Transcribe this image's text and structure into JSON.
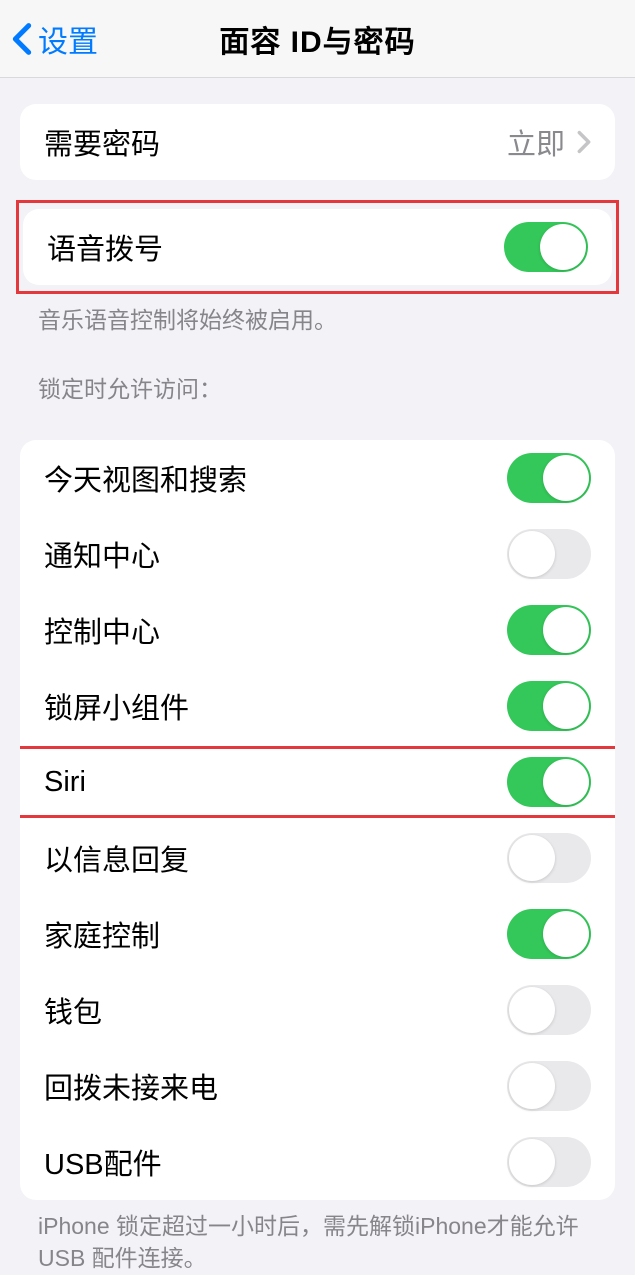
{
  "nav": {
    "back_label": "设置",
    "title": "面容 ID与密码"
  },
  "require_passcode": {
    "label": "需要密码",
    "value": "立即"
  },
  "voice_dial": {
    "label": "语音拨号",
    "on": true,
    "footer": "音乐语音控制将始终被启用。"
  },
  "lock_screen_access": {
    "header": "锁定时允许访问：",
    "items": [
      {
        "label": "今天视图和搜索",
        "on": true,
        "highlighted": false
      },
      {
        "label": "通知中心",
        "on": false,
        "highlighted": false
      },
      {
        "label": "控制中心",
        "on": true,
        "highlighted": false
      },
      {
        "label": "锁屏小组件",
        "on": true,
        "highlighted": false
      },
      {
        "label": "Siri",
        "on": true,
        "highlighted": true
      },
      {
        "label": "以信息回复",
        "on": false,
        "highlighted": false
      },
      {
        "label": "家庭控制",
        "on": true,
        "highlighted": false
      },
      {
        "label": "钱包",
        "on": false,
        "highlighted": false
      },
      {
        "label": "回拨未接来电",
        "on": false,
        "highlighted": false
      },
      {
        "label": "USB配件",
        "on": false,
        "highlighted": false
      }
    ],
    "footer": "iPhone 锁定超过一小时后，需先解锁iPhone才能允许USB 配件连接。"
  }
}
